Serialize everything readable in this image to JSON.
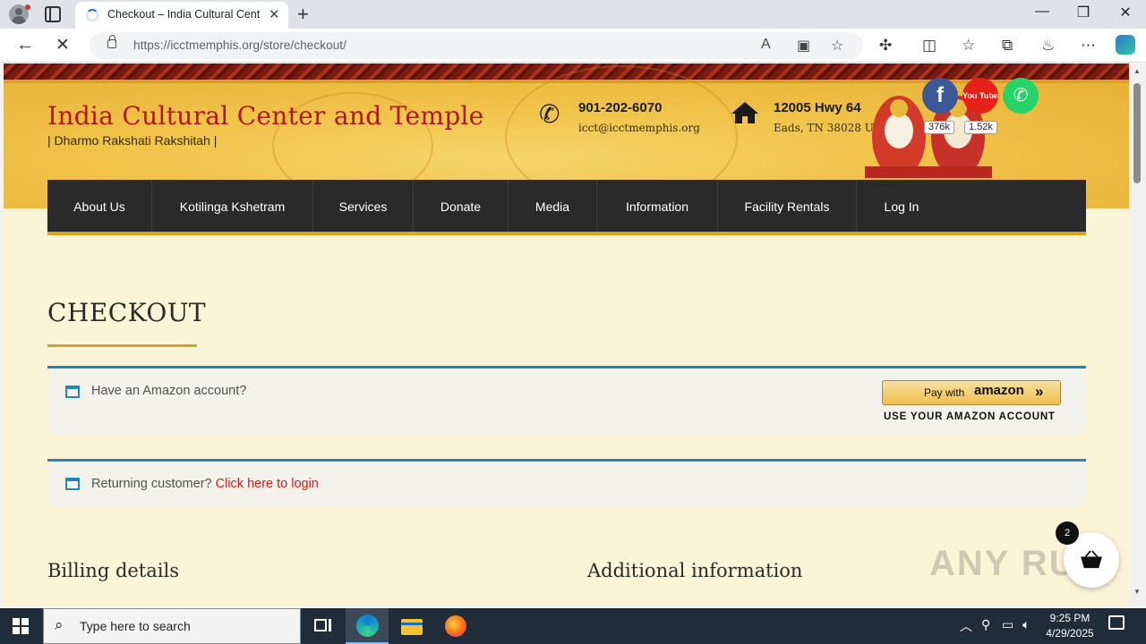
{
  "browser": {
    "tab_title": "Checkout – India Cultural Center and Temple",
    "tab_close": "✕",
    "new_tab": "+",
    "url_host": "https://icctmemphis.org",
    "url_path": "/store/checkout/",
    "window_controls": [
      "—",
      "❐",
      "✕"
    ]
  },
  "site": {
    "title": "India Cultural Center and Temple",
    "tagline": "| Dharmo Rakshati Rakshitah |",
    "phone": "901-202-6070",
    "email": "icct@icctmemphis.org",
    "address_line1": "12005 Hwy 64",
    "address_line2": "Eads, TN 38028 USA",
    "social": [
      {
        "name": "facebook",
        "glyph": "f",
        "count": "376k",
        "color": "#3b5998"
      },
      {
        "name": "youtube",
        "glyph": "You Tube",
        "count": "1.52k",
        "color": "#e62117"
      },
      {
        "name": "whatsapp",
        "glyph": "✆",
        "count": "",
        "color": "#25d366"
      }
    ]
  },
  "nav": {
    "items": [
      "About Us",
      "Kotilinga Kshetram",
      "Services",
      "Donate",
      "Media",
      "Information",
      "Facility Rentals",
      "Log In"
    ]
  },
  "checkout": {
    "heading": "CHECKOUT",
    "amazon_notice": "Have an Amazon account?",
    "amazon_button_prefix": "Pay with",
    "amazon_button_brand": "amazon",
    "amazon_button_arrows": "»",
    "amazon_subtext": "USE YOUR AMAZON ACCOUNT",
    "returning_text": "Returning customer?",
    "returning_link": "Click here to login",
    "billing_heading": "Billing details",
    "additional_heading": "Additional information",
    "cart_count": "2"
  },
  "watermark": "ANY RUN",
  "taskbar": {
    "search_placeholder": "Type here to search",
    "time": "9:25 PM",
    "date": "4/29/2025"
  }
}
